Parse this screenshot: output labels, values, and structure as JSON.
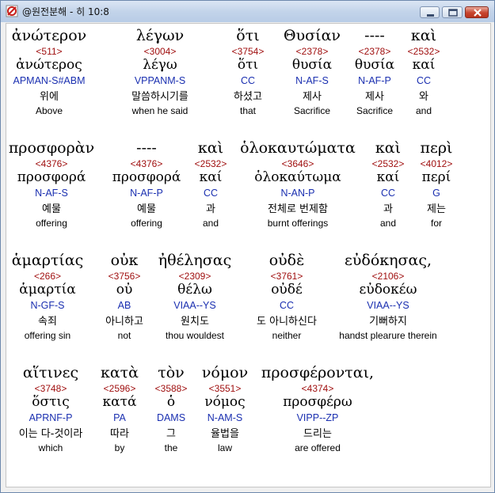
{
  "window": {
    "title": "@원전분해 - 히 10:8"
  },
  "icons": {
    "app": "app-icon",
    "minimize": "minimize-icon",
    "maximize": "maximize-icon",
    "close": "close-icon"
  },
  "rows": [
    {
      "words": [
        {
          "greek": "ἀνώτερον",
          "strong": "<511>",
          "lemma": "ἀνώτερος",
          "parse": "APMAN-S#ABM",
          "korean": "위에",
          "english": "Above"
        },
        {
          "greek": "λέγων",
          "strong": "<3004>",
          "lemma": "λέγω",
          "parse": "VPPANM-S",
          "korean": "말씀하시기를",
          "english": "when he said"
        },
        {
          "greek": "ὅτι",
          "strong": "<3754>",
          "lemma": "ὅτι",
          "parse": "CC",
          "korean": "하셨고",
          "english": "that"
        },
        {
          "greek": "Θυσίαν",
          "strong": "<2378>",
          "lemma": "θυσία",
          "parse": "N-AF-S",
          "korean": "제사",
          "english": "Sacrifice"
        },
        {
          "greek": "----",
          "strong": "<2378>",
          "lemma": "θυσία",
          "parse": "N-AF-P",
          "korean": "제사",
          "english": "Sacrifice"
        },
        {
          "greek": "καὶ",
          "strong": "<2532>",
          "lemma": "καί",
          "parse": "CC",
          "korean": "와",
          "english": "and"
        }
      ]
    },
    {
      "words": [
        {
          "greek": "προσφορὰν",
          "strong": "<4376>",
          "lemma": "προσφορά",
          "parse": "N-AF-S",
          "korean": "예물",
          "english": "offering"
        },
        {
          "greek": "----",
          "strong": "<4376>",
          "lemma": "προσφορά",
          "parse": "N-AF-P",
          "korean": "예물",
          "english": "offering"
        },
        {
          "greek": "καὶ",
          "strong": "<2532>",
          "lemma": "καί",
          "parse": "CC",
          "korean": "과",
          "english": "and"
        },
        {
          "greek": "ὁλοκαυτώματα",
          "strong": "<3646>",
          "lemma": "ὁλοκαύτωμα",
          "parse": "N-AN-P",
          "korean": "전체로 번제함",
          "english": "burnt offerings"
        },
        {
          "greek": "καὶ",
          "strong": "<2532>",
          "lemma": "καί",
          "parse": "CC",
          "korean": "과",
          "english": "and"
        },
        {
          "greek": "περὶ",
          "strong": "<4012>",
          "lemma": "περί",
          "parse": "G",
          "korean": "제는",
          "english": "for"
        }
      ]
    },
    {
      "words": [
        {
          "greek": "ἁμαρτίας",
          "strong": "<266>",
          "lemma": "ἁμαρτία",
          "parse": "N-GF-S",
          "korean": "속죄",
          "english": "offering sin"
        },
        {
          "greek": "οὐκ",
          "strong": "<3756>",
          "lemma": "οὐ",
          "parse": "AB",
          "korean": "아니하고",
          "english": "not"
        },
        {
          "greek": "ἠθέλησας",
          "strong": "<2309>",
          "lemma": "θέλω",
          "parse": "VIAA--YS",
          "korean": "원치도",
          "english": "thou wouldest"
        },
        {
          "greek": "οὐδὲ",
          "strong": "<3761>",
          "lemma": "οὐδέ",
          "parse": "CC",
          "korean": "도 아니하신다",
          "english": "neither"
        },
        {
          "greek": "εὐδόκησας,",
          "strong": "<2106>",
          "lemma": "εὐδοκέω",
          "parse": "VIAA--YS",
          "korean": "기뻐하지",
          "english": "handst plearure therein"
        }
      ]
    },
    {
      "words": [
        {
          "greek": "αἵτινες",
          "strong": "<3748>",
          "lemma": "ὅστις",
          "parse": "APRNF-P",
          "korean": "이는 다-것이라",
          "english": "which"
        },
        {
          "greek": "κατὰ",
          "strong": "<2596>",
          "lemma": "κατά",
          "parse": "PA",
          "korean": "따라",
          "english": "by"
        },
        {
          "greek": "τὸν",
          "strong": "<3588>",
          "lemma": "ὁ",
          "parse": "DAMS",
          "korean": "그",
          "english": "the"
        },
        {
          "greek": "νόμον",
          "strong": "<3551>",
          "lemma": "νόμος",
          "parse": "N-AM-S",
          "korean": "율법을",
          "english": "law"
        },
        {
          "greek": "προσφέρονται,",
          "strong": "<4374>",
          "lemma": "προσφέρω",
          "parse": "VIPP--ZP",
          "korean": "드리는",
          "english": "are offered"
        }
      ]
    }
  ]
}
